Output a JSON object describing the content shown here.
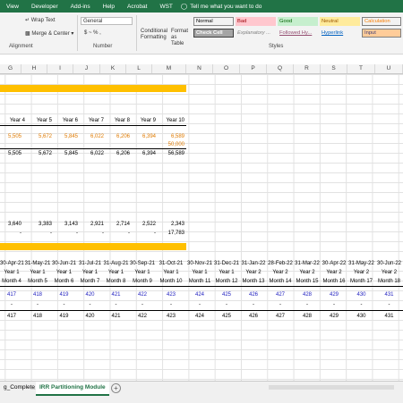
{
  "menu": {
    "items": [
      "View",
      "Developer",
      "Add-ins",
      "Help",
      "Acrobat",
      "WST"
    ],
    "tell_me": "Tell me what you want to do"
  },
  "ribbon": {
    "wrap_text": "Wrap Text",
    "merge_center": "Merge & Center",
    "number_format": "General",
    "number_symbols": "$ ~ % ,",
    "conditional_formatting": "Conditional Formatting",
    "format_as_table": "Format as Table",
    "groups": {
      "alignment": "Alignment",
      "number": "Number",
      "styles": "Styles"
    },
    "styles": [
      {
        "label": "Normal",
        "bg": "#ffffff",
        "fg": "#000000"
      },
      {
        "label": "Bad",
        "bg": "#ffc7ce",
        "fg": "#9c0006"
      },
      {
        "label": "Good",
        "bg": "#c6efce",
        "fg": "#006100"
      },
      {
        "label": "Neutral",
        "bg": "#ffeb9c",
        "fg": "#9c5700"
      },
      {
        "label": "Calculation",
        "bg": "#f2f2f2",
        "fg": "#fa7d00"
      },
      {
        "label": "Check Cell",
        "bg": "#a5a5a5",
        "fg": "#ffffff"
      },
      {
        "label": "Explanatory ...",
        "bg": "#ffffff",
        "fg": "#7f7f7f"
      },
      {
        "label": "Followed Hy...",
        "bg": "#ffffff",
        "fg": "#954f72"
      },
      {
        "label": "Hyperlink",
        "bg": "#ffffff",
        "fg": "#0563c1"
      },
      {
        "label": "Input",
        "bg": "#ffcc99",
        "fg": "#3f3f76"
      }
    ]
  },
  "columns": [
    "G",
    "H",
    "I",
    "J",
    "K",
    "L",
    "M",
    "N",
    "O",
    "P",
    "Q",
    "R",
    "S",
    "T",
    "U"
  ],
  "years_row": [
    "Year 4",
    "Year 5",
    "Year 6",
    "Year 7",
    "Year 8",
    "Year 9",
    "Year 10"
  ],
  "orange_row": [
    "5,505",
    "5,672",
    "5,845",
    "6,022",
    "6,206",
    "6,394",
    "6,589"
  ],
  "orange_row2_m": "50,000",
  "total_row": [
    "5,505",
    "5,672",
    "5,845",
    "6,022",
    "6,206",
    "6,394",
    "56,589"
  ],
  "row_b": [
    "3,640",
    "3,383",
    "3,143",
    "2,921",
    "2,714",
    "2,522",
    "2,343"
  ],
  "row_b_dashes": [
    "-",
    "-",
    "-",
    "-",
    "-",
    "-"
  ],
  "row_b2_m": "17,783",
  "dates": [
    "30-Apr-21",
    "31-May-21",
    "30-Jun-21",
    "31-Jul-21",
    "31-Aug-21",
    "30-Sep-21",
    "31-Oct-21",
    "30-Nov-21",
    "31-Dec-21",
    "31-Jan-22",
    "28-Feb-22",
    "31-Mar-22",
    "30-Apr-22",
    "31-May-22",
    "30-Jun-22"
  ],
  "year_labels": [
    "Year 1",
    "Year 1",
    "Year 1",
    "Year 1",
    "Year 1",
    "Year 1",
    "Year 1",
    "Year 1",
    "Year 1",
    "Year 2",
    "Year 2",
    "Year 2",
    "Year 2",
    "Year 2",
    "Year 2"
  ],
  "months": [
    "Month 4",
    "Month 5",
    "Month 6",
    "Month 7",
    "Month 8",
    "Month 9",
    "Month 10",
    "Month 11",
    "Month 12",
    "Month 13",
    "Month 14",
    "Month 15",
    "Month 16",
    "Month 17",
    "Month 18"
  ],
  "blue_vals": [
    "417",
    "418",
    "419",
    "420",
    "421",
    "422",
    "423",
    "424",
    "425",
    "426",
    "427",
    "428",
    "429",
    "430",
    "431"
  ],
  "dash_row": [
    "-",
    "-",
    "-",
    "-",
    "-",
    "-",
    "-",
    "-",
    "-",
    "-",
    "-",
    "-",
    "-",
    "-",
    "-"
  ],
  "black_vals": [
    "417",
    "418",
    "419",
    "420",
    "421",
    "422",
    "423",
    "424",
    "425",
    "426",
    "427",
    "428",
    "429",
    "430",
    "431"
  ],
  "tabs": {
    "prev": "g_Complete",
    "active": "IRR Partitioning Module",
    "add": "+"
  },
  "colors": {
    "excel_green": "#217346",
    "accent_yellow": "#ffc000",
    "orange_text": "#e07b00",
    "blue_text": "#1f1fbf"
  }
}
